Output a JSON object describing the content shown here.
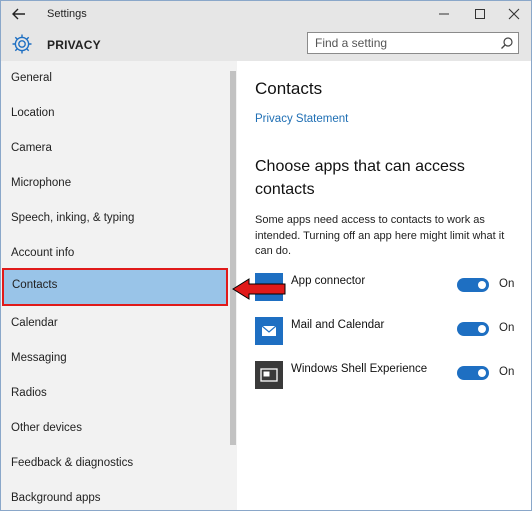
{
  "window": {
    "title": "Settings"
  },
  "header": {
    "section": "PRIVACY",
    "search_placeholder": "Find a setting"
  },
  "sidebar": {
    "items": [
      {
        "label": "General"
      },
      {
        "label": "Location"
      },
      {
        "label": "Camera"
      },
      {
        "label": "Microphone"
      },
      {
        "label": "Speech, inking, & typing"
      },
      {
        "label": "Account info"
      },
      {
        "label": "Contacts",
        "selected": true
      },
      {
        "label": "Calendar"
      },
      {
        "label": "Messaging"
      },
      {
        "label": "Radios"
      },
      {
        "label": "Other devices"
      },
      {
        "label": "Feedback & diagnostics"
      },
      {
        "label": "Background apps"
      }
    ]
  },
  "main": {
    "title": "Contacts",
    "privacy_link": "Privacy Statement",
    "subtitle": "Choose apps that can access contacts",
    "description": "Some apps need access to contacts to work as intended. Turning off an app here might limit what it can do.",
    "apps": [
      {
        "name": "App connector",
        "state": "On",
        "icon": "app-connector-icon"
      },
      {
        "name": "Mail and Calendar",
        "state": "On",
        "icon": "mail-icon"
      },
      {
        "name": "Windows Shell Experience",
        "state": "On",
        "icon": "shell-icon"
      }
    ]
  },
  "colors": {
    "accent": "#1e6fc2",
    "selected_bg": "#99c4e8",
    "highlight_border": "#e01a1a",
    "link": "#1f6fb4"
  }
}
